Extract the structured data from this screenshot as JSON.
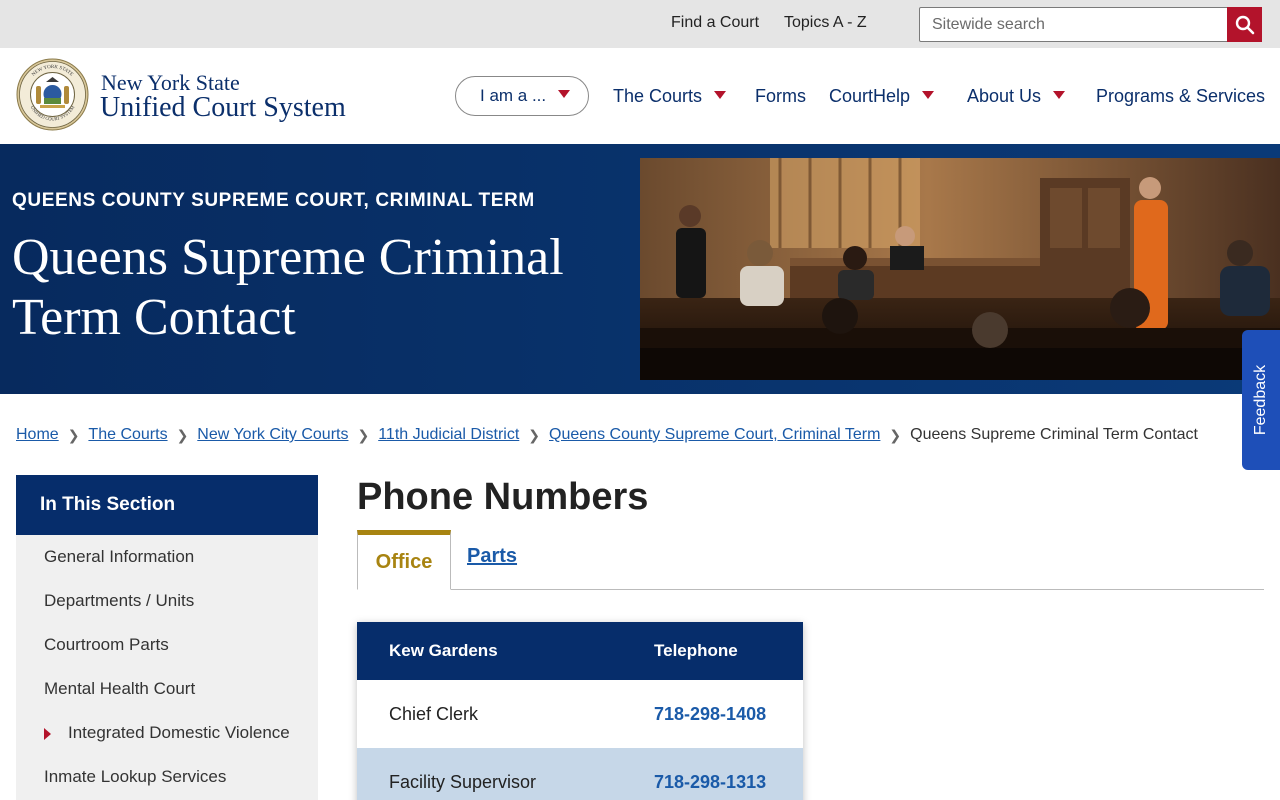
{
  "utility_bar": {
    "links": [
      "Find a Court",
      "Topics A - Z"
    ],
    "search_placeholder": "Sitewide search",
    "search_icon": "search-icon"
  },
  "header": {
    "logo_line1": "New York State",
    "logo_line2": "Unified Court System",
    "seal_text_top": "NEW YORK STATE",
    "seal_text_bottom": "UNIFIED COURT SYSTEM",
    "i_am_a": "I am a ...",
    "nav": [
      "The Courts",
      "Forms",
      "CourtHelp",
      "About Us",
      "Programs & Services"
    ]
  },
  "hero": {
    "eyebrow": "QUEENS COUNTY SUPREME COURT, CRIMINAL TERM",
    "title": "Queens Supreme Criminal Term Contact"
  },
  "feedback": {
    "label": "Feedback"
  },
  "breadcrumb": {
    "links": [
      "Home",
      "The Courts",
      "New York City Courts",
      "11th Judicial District",
      "Queens County Supreme Court, Criminal Term"
    ],
    "current": "Queens Supreme Criminal Term Contact"
  },
  "sidebar": {
    "heading": "In This Section",
    "items": [
      "General Information",
      "Departments / Units",
      "Courtroom Parts",
      "Mental Health Court",
      "Integrated Domestic Violence",
      "Inmate Lookup Services"
    ]
  },
  "main": {
    "title": "Phone Numbers",
    "tabs": [
      "Office",
      "Parts"
    ],
    "table": {
      "headers": [
        "Kew Gardens",
        "Telephone"
      ],
      "rows": [
        [
          "Chief Clerk",
          "718-298-1408"
        ],
        [
          "Facility Supervisor",
          "718-298-1313"
        ]
      ]
    }
  },
  "colors": {
    "navy": "#062d6b",
    "accent_red": "#b3132b",
    "gold": "#a88411",
    "link_blue": "#1a5aa8"
  }
}
